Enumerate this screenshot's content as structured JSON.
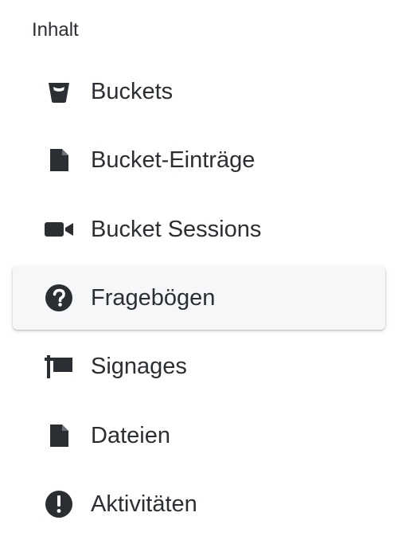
{
  "sidebar": {
    "section_title": "Inhalt",
    "items": [
      {
        "label": "Buckets",
        "icon": "bucket-icon",
        "active": false
      },
      {
        "label": "Bucket-Einträge",
        "icon": "file-icon",
        "active": false
      },
      {
        "label": "Bucket Sessions",
        "icon": "video-camera-icon",
        "active": false
      },
      {
        "label": "Fragebögen",
        "icon": "question-circle-icon",
        "active": true
      },
      {
        "label": "Signages",
        "icon": "sign-icon",
        "active": false
      },
      {
        "label": "Dateien",
        "icon": "file-icon",
        "active": false
      },
      {
        "label": "Aktivitäten",
        "icon": "exclamation-circle-icon",
        "active": false
      }
    ]
  },
  "colors": {
    "text": "#2b2e33",
    "icon": "#2b2e33",
    "active_background": "#f5f7f9"
  }
}
